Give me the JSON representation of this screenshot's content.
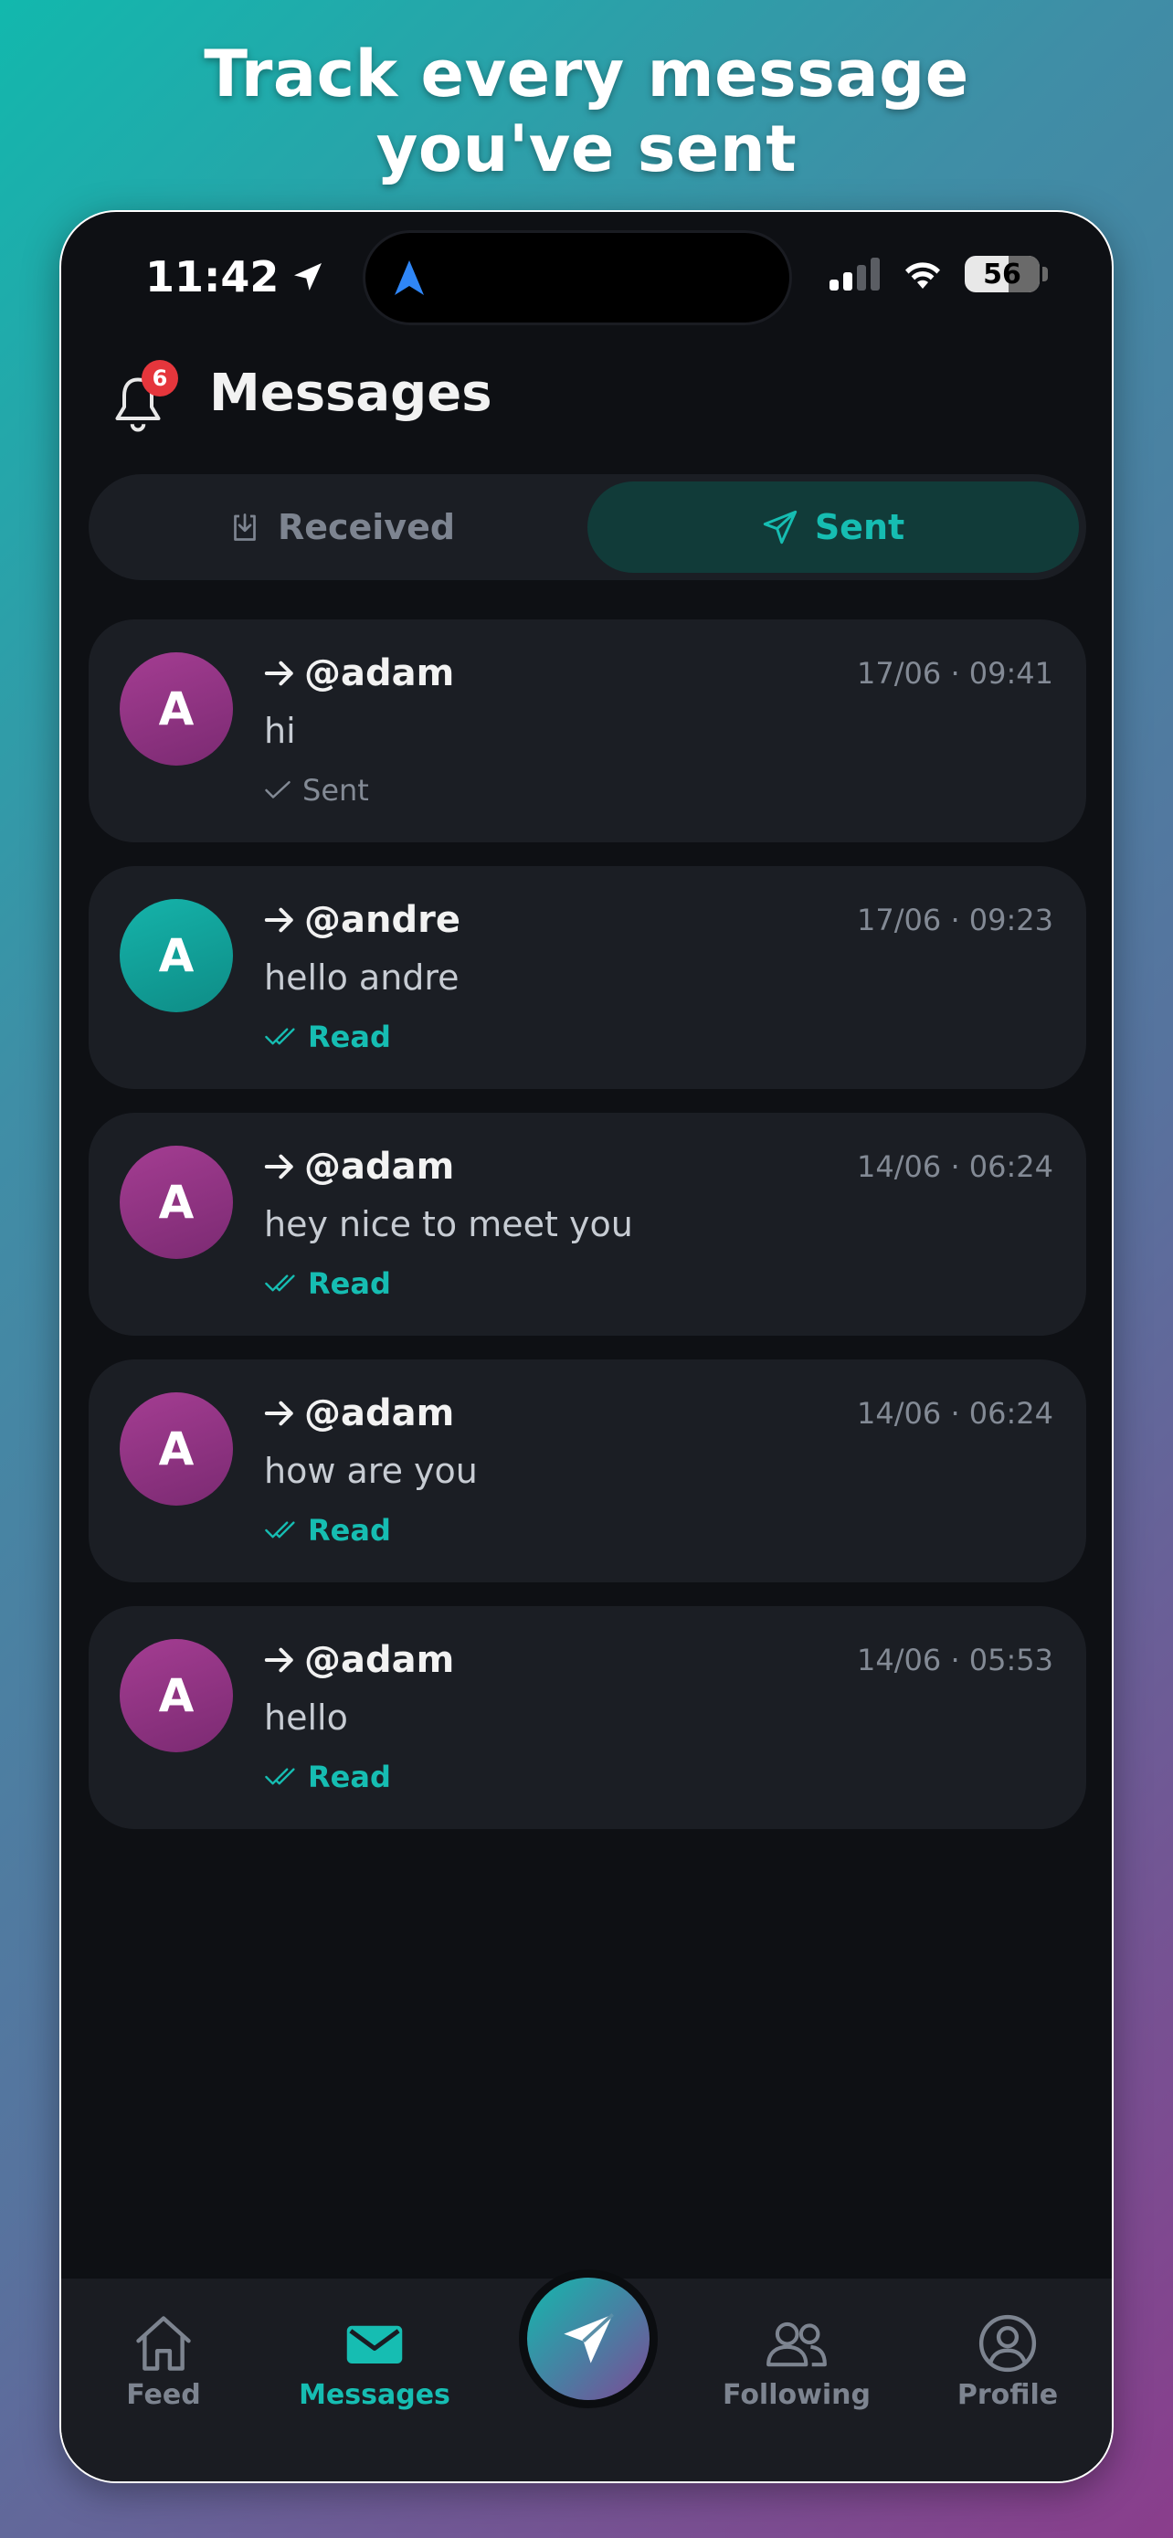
{
  "headline": {
    "line1": "Track every message",
    "line2": "you've sent"
  },
  "status_bar": {
    "time": "11:42",
    "battery": "56"
  },
  "header": {
    "title": "Messages",
    "notification_count": "6"
  },
  "tabs": [
    {
      "label": "Received",
      "active": false
    },
    {
      "label": "Sent",
      "active": true
    }
  ],
  "messages": [
    {
      "avatar_letter": "A",
      "avatar_color": "#8e3483",
      "recipient": "@adam",
      "timestamp": "17/06 · 09:41",
      "text": "hi",
      "status": "Sent"
    },
    {
      "avatar_letter": "A",
      "avatar_color": "#13a79f",
      "recipient": "@andre",
      "timestamp": "17/06 · 09:23",
      "text": "hello andre",
      "status": "Read"
    },
    {
      "avatar_letter": "A",
      "avatar_color": "#8e3483",
      "recipient": "@adam",
      "timestamp": "14/06 · 06:24",
      "text": "hey nice to meet you",
      "status": "Read"
    },
    {
      "avatar_letter": "A",
      "avatar_color": "#8e3483",
      "recipient": "@adam",
      "timestamp": "14/06 · 06:24",
      "text": "how are you",
      "status": "Read"
    },
    {
      "avatar_letter": "A",
      "avatar_color": "#8e3483",
      "recipient": "@adam",
      "timestamp": "14/06 · 05:53",
      "text": "hello",
      "status": "Read"
    }
  ],
  "bottom_nav": {
    "feed": "Feed",
    "messages": "Messages",
    "following": "Following",
    "profile": "Profile"
  },
  "colors": {
    "accent": "#16bdb2",
    "background": "#0e1014",
    "card": "#1b1e24",
    "badge": "#e5363c"
  },
  "icons": [
    "location-arrow-icon",
    "navigation-icon",
    "signal-icon",
    "wifi-icon",
    "battery-icon",
    "bell-icon",
    "inbox-download-icon",
    "send-icon",
    "arrow-right-icon",
    "check-icon",
    "double-check-icon",
    "home-icon",
    "mail-icon",
    "paper-plane-icon",
    "users-icon",
    "user-circle-icon"
  ]
}
